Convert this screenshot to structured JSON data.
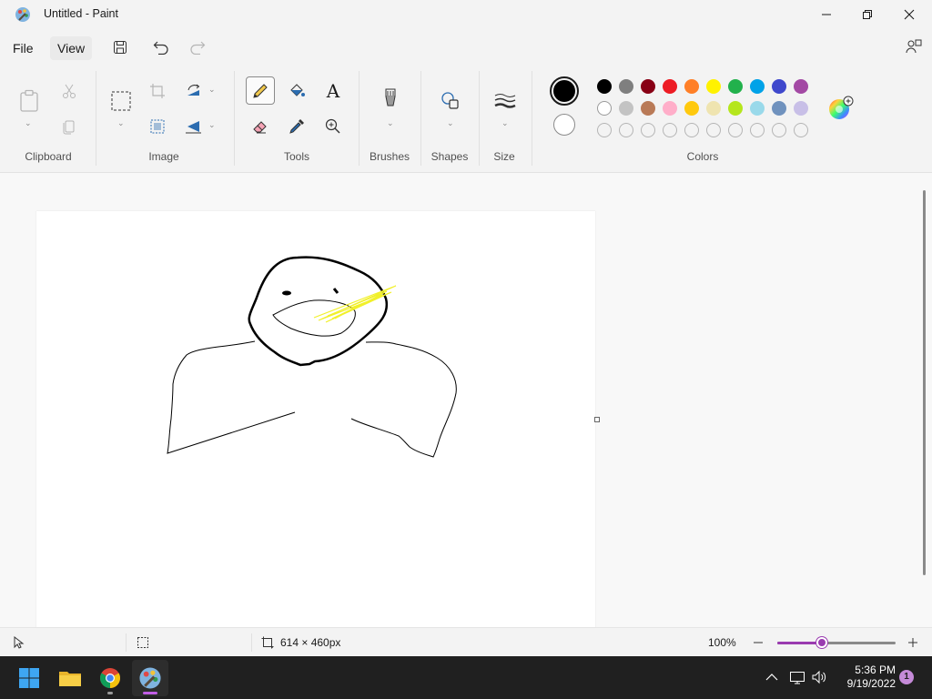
{
  "window": {
    "title": "Untitled - Paint"
  },
  "menu": {
    "file": "File",
    "view": "View"
  },
  "ribbon": {
    "groups": {
      "clipboard": "Clipboard",
      "image": "Image",
      "tools": "Tools",
      "brushes": "Brushes",
      "shapes": "Shapes",
      "size": "Size",
      "colors": "Colors"
    },
    "text_tool_glyph": "A",
    "selected_tool": "pencil",
    "primary_color": "#000000",
    "secondary_color": "#ffffff",
    "palette_row1": [
      "#000000",
      "#7f7f7f",
      "#880015",
      "#ed1c24",
      "#ff7f27",
      "#fff200",
      "#22b14c",
      "#00a2e8",
      "#3f48cc",
      "#a349a4"
    ],
    "palette_row2": [
      "#ffffff",
      "#c3c3c3",
      "#b97a57",
      "#ffaec9",
      "#ffc90e",
      "#efe4b0",
      "#b5e61d",
      "#99d9ea",
      "#7092be",
      "#c8bfe7"
    ],
    "palette_row3_empty_count": 10
  },
  "status": {
    "canvas_size": "614 × 460px",
    "zoom": "100%",
    "zoom_level": 0.38
  },
  "taskbar": {
    "apps": [
      "start-icon",
      "file-explorer-icon",
      "chrome-icon",
      "paint-icon"
    ],
    "time": "5:36 PM",
    "date": "9/19/2022",
    "notification_count": "1"
  }
}
